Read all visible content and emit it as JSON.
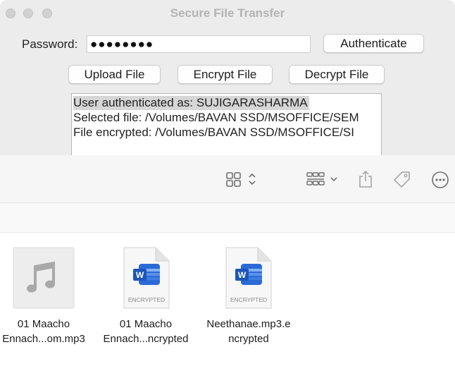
{
  "app": {
    "title": "Secure File Transfer",
    "password_label": "Password:",
    "password_value": "●●●●●●●●",
    "buttons": {
      "authenticate": "Authenticate",
      "upload": "Upload File",
      "encrypt": "Encrypt File",
      "decrypt": "Decrypt File"
    },
    "log_lines": [
      "User authenticated as: SUJIGARASHARMA",
      "Selected file: /Volumes/BAVAN SSD/MSOFFICE/SEM",
      "File encrypted: /Volumes/BAVAN SSD/MSOFFICE/SI"
    ]
  },
  "finder": {
    "toolbar_icons": [
      "icon-view-grid-icon",
      "group-by-icon",
      "share-icon",
      "tag-icon",
      "more-options-icon"
    ],
    "files": [
      {
        "name_line1": "01 Maacho",
        "name_line2": "Ennach...om.mp3",
        "icon": "audio-file-icon"
      },
      {
        "name_line1": "01 Maacho",
        "name_line2": "Ennach...ncrypted",
        "icon": "word-document-icon",
        "badge": "ENCRYPTED"
      },
      {
        "name_line1": "Neethanae.mp3.e",
        "name_line2": "ncrypted",
        "icon": "word-document-icon",
        "badge": "ENCRYPTED"
      }
    ]
  },
  "colors": {
    "word_blue": "#2b6ad6",
    "window_gray": "#ececec"
  }
}
